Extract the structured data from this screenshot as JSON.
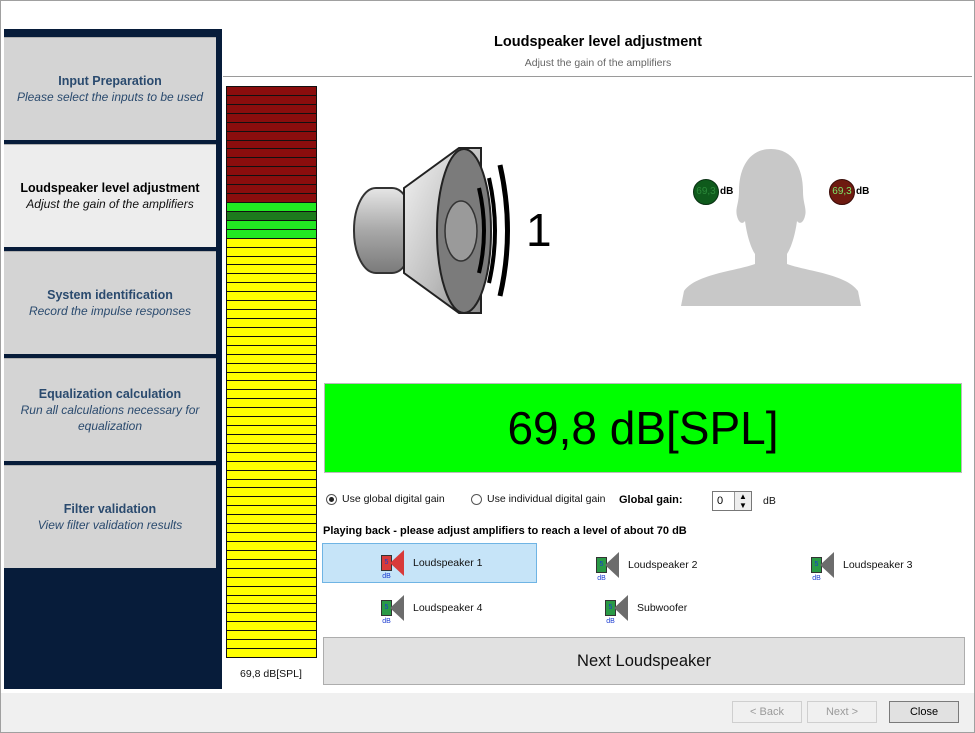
{
  "header": {
    "title": "Loudspeaker level adjustment",
    "subtitle": "Adjust the gain of the amplifiers"
  },
  "sidebar": {
    "steps": [
      {
        "title": "Input Preparation",
        "subtitle": "Please select the inputs to be used",
        "active": false
      },
      {
        "title": "Loudspeaker level adjustment",
        "subtitle": "Adjust the gain of the amplifiers",
        "active": true
      },
      {
        "title": "System identification",
        "subtitle": "Record the impulse responses",
        "active": false
      },
      {
        "title": "Equalization calculation",
        "subtitle": "Run all calculations necessary for equalization",
        "active": false
      },
      {
        "title": "Filter validation",
        "subtitle": "View filter validation results",
        "active": false
      }
    ]
  },
  "meter": {
    "label": "69,8 dB[SPL]",
    "colors": {
      "red": "#8b0d0d",
      "green": "#22e822",
      "dark_green": "#1d7a1d",
      "yellow": "#ffff00"
    }
  },
  "speaker": {
    "number": "1"
  },
  "head": {
    "left_ear_value": "69,3",
    "left_ear_unit": "dB",
    "right_ear_value": "69,3",
    "right_ear_unit": "dB"
  },
  "spl_display": {
    "text": "69,8 dB[SPL]",
    "color": "#00ff00"
  },
  "gain": {
    "radio_global": "Use global digital gain",
    "radio_individual": "Use individual digital gain",
    "selected": "global",
    "global_label": "Global gain:",
    "global_value": "0",
    "unit": "dB"
  },
  "playing_message": "Playing back - please adjust amplifiers to reach a level of about 70 dB",
  "loudspeakers": [
    {
      "label": "Loudspeaker 1",
      "badge": "5 dB",
      "selected": true
    },
    {
      "label": "Loudspeaker 2",
      "badge": "5 dB",
      "selected": false
    },
    {
      "label": "Loudspeaker 3",
      "badge": "5 dB",
      "selected": false
    },
    {
      "label": "Loudspeaker 4",
      "badge": "5 dB",
      "selected": false
    },
    {
      "label": "Subwoofer",
      "badge": "5 dB",
      "selected": false
    }
  ],
  "next_loudspeaker_label": "Next Loudspeaker",
  "nav": {
    "back_label": "< Back",
    "next_label": "Next >",
    "close_label": "Close"
  }
}
